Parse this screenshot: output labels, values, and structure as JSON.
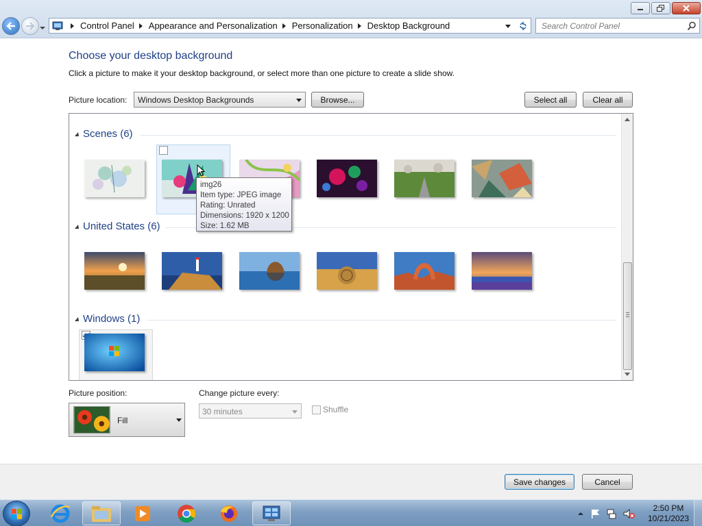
{
  "window": {
    "buttons": [
      "minimize",
      "maximize",
      "close"
    ]
  },
  "address_bar": {
    "breadcrumbs": [
      "Control Panel",
      "Appearance and Personalization",
      "Personalization",
      "Desktop Background"
    ]
  },
  "search": {
    "placeholder": "Search Control Panel"
  },
  "page": {
    "title": "Choose your desktop background",
    "subtitle": "Click a picture to make it your desktop background, or select more than one picture to create a slide show."
  },
  "picture_location": {
    "label": "Picture location:",
    "value": "Windows Desktop Backgrounds",
    "browse_label": "Browse...",
    "select_all_label": "Select all",
    "clear_all_label": "Clear all"
  },
  "groups": [
    {
      "title": "Scenes (6)",
      "count": 6
    },
    {
      "title": "United States (6)",
      "count": 6
    },
    {
      "title": "Windows (1)",
      "count": 1
    }
  ],
  "tooltip": {
    "name": "img26",
    "type": "Item type: JPEG image",
    "rating": "Rating: Unrated",
    "dimensions": "Dimensions: 1920 x 1200",
    "size": "Size: 1.62 MB"
  },
  "picture_position": {
    "label": "Picture position:",
    "value": "Fill"
  },
  "change_picture": {
    "label": "Change picture every:",
    "value": "30 minutes"
  },
  "shuffle": {
    "label": "Shuffle",
    "checked": false
  },
  "footer": {
    "save_label": "Save changes",
    "cancel_label": "Cancel"
  },
  "taskbar": {
    "apps": [
      "internet-explorer",
      "windows-explorer",
      "media-player",
      "chrome",
      "firefox",
      "control-panel"
    ],
    "time": "2:50 PM",
    "date": "10/21/2023"
  },
  "colors": {
    "heading": "#1e3f87",
    "taskbar": "#7f9fc2",
    "selection": "#eaf3fd"
  }
}
